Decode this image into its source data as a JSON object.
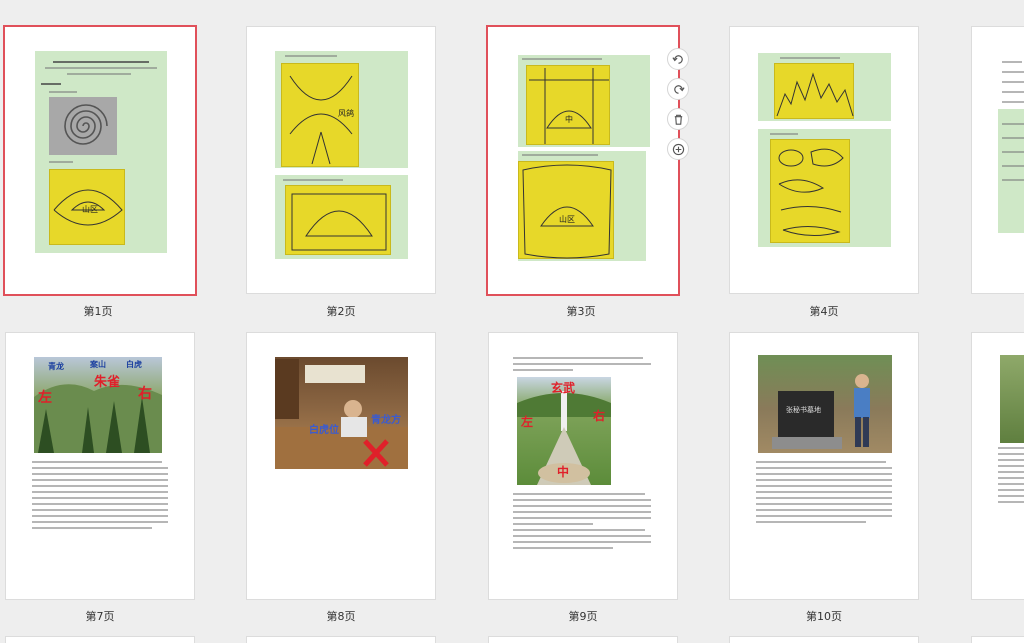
{
  "pages": [
    {
      "label": "第1页",
      "selected": true
    },
    {
      "label": "第2页",
      "selected": false
    },
    {
      "label": "第3页",
      "selected": true
    },
    {
      "label": "第4页",
      "selected": false
    },
    {
      "label": "第7页",
      "selected": false
    },
    {
      "label": "第8页",
      "selected": false
    },
    {
      "label": "第9页",
      "selected": false
    },
    {
      "label": "第10页",
      "selected": false
    }
  ],
  "page1": {
    "heading": "第一章 正确的生命的与外化至真在都懂在大",
    "section": "一、风辉",
    "sub1": "1、地图中国",
    "sub2": "2、生化图",
    "drawing_label": "山区"
  },
  "page2": {
    "caption1": "2、人生发展之形",
    "caption2": "3、中化，学从根据就都好",
    "mark": "风鸽"
  },
  "page3": {
    "caption1": "5、外村的，中州的气是（中根德德）",
    "caption2": "6、风格研就第度，美为分子",
    "center1": "中",
    "center2": "山区"
  },
  "page4": {
    "caption1": "7、基本（北地地法比地风法）",
    "caption2": "8、都中山"
  },
  "page7": {
    "photo_labels": [
      "青龙",
      "案山",
      "白虎"
    ],
    "red_marks": [
      "左",
      "右",
      "朱雀"
    ]
  },
  "page8": {
    "photo_labels": [
      "白虎位",
      "青龙方"
    ]
  },
  "page9": {
    "red_marks": [
      "玄武",
      "左",
      "右",
      "中"
    ]
  },
  "page10": {
    "stone_text": "张秘书墓地"
  },
  "toolbar": {
    "rotate_left": "rotate-left",
    "rotate_right": "rotate-right",
    "delete": "trash",
    "insert": "plus-circle"
  }
}
